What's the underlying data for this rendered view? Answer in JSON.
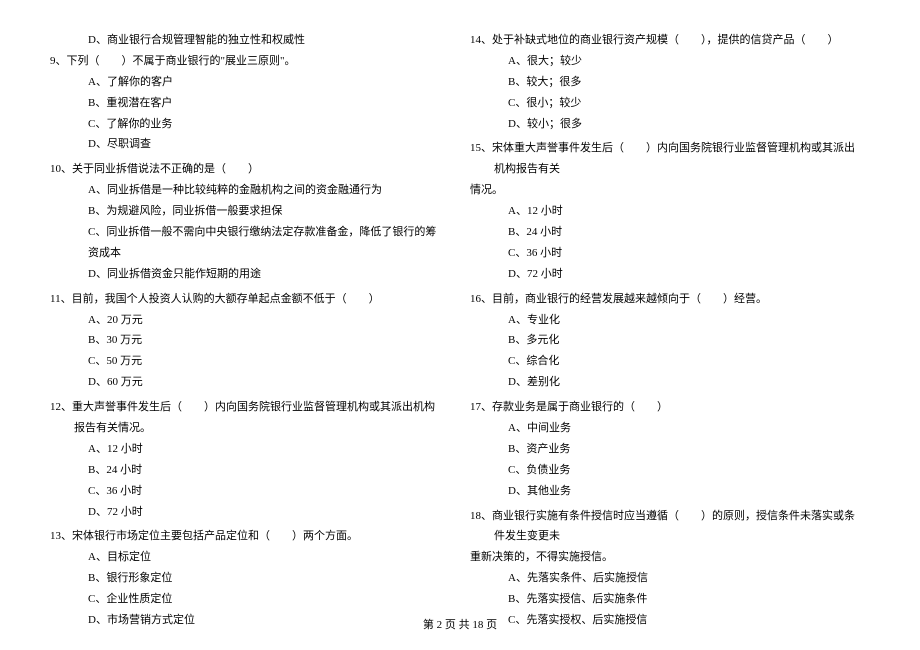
{
  "left": {
    "prev_option_d": "D、商业银行合规管理智能的独立性和权威性",
    "q9": {
      "stem": "9、下列（　　）不属于商业银行的\"展业三原则\"。",
      "a": "A、了解你的客户",
      "b": "B、重视潜在客户",
      "c": "C、了解你的业务",
      "d": "D、尽职调查"
    },
    "q10": {
      "stem": "10、关于同业拆借说法不正确的是（　　）",
      "a": "A、同业拆借是一种比较纯粹的金融机构之间的资金融通行为",
      "b": "B、为规避风险，同业拆借一般要求担保",
      "c": "C、同业拆借一般不需向中央银行缴纳法定存款准备金，降低了银行的筹资成本",
      "d": "D、同业拆借资金只能作短期的用途"
    },
    "q11": {
      "stem": "11、目前，我国个人投资人认购的大额存单起点金额不低于（　　）",
      "a": "A、20 万元",
      "b": "B、30 万元",
      "c": "C、50 万元",
      "d": "D、60 万元"
    },
    "q12": {
      "stem": "12、重大声誉事件发生后（　　）内向国务院银行业监督管理机构或其派出机构报告有关情况。",
      "a": "A、12 小时",
      "b": "B、24 小时",
      "c": "C、36 小时",
      "d": "D、72 小时"
    },
    "q13": {
      "stem": "13、宋体银行市场定位主要包括产品定位和（　　）两个方面。",
      "a": "A、目标定位",
      "b": "B、银行形象定位",
      "c": "C、企业性质定位",
      "d": "D、市场营销方式定位"
    }
  },
  "right": {
    "q14": {
      "stem": "14、处于补缺式地位的商业银行资产规模（　　），提供的信贷产品（　　）",
      "a": "A、很大；较少",
      "b": "B、较大；很多",
      "c": "C、很小；较少",
      "d": "D、较小；很多"
    },
    "q15": {
      "stem": "15、宋体重大声誉事件发生后（　　）内向国务院银行业监督管理机构或其派出机构报告有关",
      "cont": "情况。",
      "a": "A、12 小时",
      "b": "B、24 小时",
      "c": "C、36 小时",
      "d": "D、72 小时"
    },
    "q16": {
      "stem": "16、目前，商业银行的经营发展越来越倾向于（　　）经营。",
      "a": "A、专业化",
      "b": "B、多元化",
      "c": "C、综合化",
      "d": "D、差别化"
    },
    "q17": {
      "stem": "17、存款业务是属于商业银行的（　　）",
      "a": "A、中间业务",
      "b": "B、资产业务",
      "c": "C、负债业务",
      "d": "D、其他业务"
    },
    "q18": {
      "stem": "18、商业银行实施有条件授信时应当遵循（　　）的原则，授信条件未落实或条件发生变更未",
      "cont": "重新决策的，不得实施授信。",
      "a": "A、先落实条件、后实施授信",
      "b": "B、先落实授信、后实施条件",
      "c": "C、先落实授权、后实施授信"
    }
  },
  "footer": "第 2 页 共 18 页"
}
